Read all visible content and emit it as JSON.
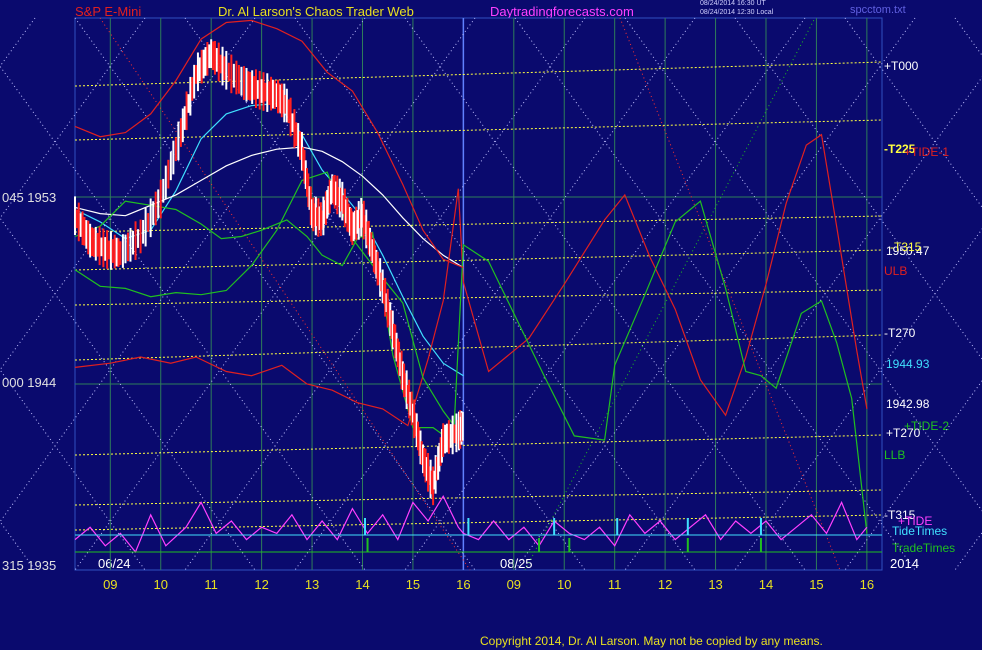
{
  "header": {
    "left_title": "S&P E-Mini",
    "center_title": "Dr. Al Larson's Chaos Trader Web",
    "site": "Daytradingforecasts.com",
    "stamp_line1": "08/24/2014 16:30 UT",
    "stamp_line2": "08/24/2014 12:30 Local",
    "file": "spcctom.txt"
  },
  "footer": {
    "copyright": "Copyright 2014, Dr. Al Larson. May not be copied by any means."
  },
  "colors": {
    "background": "#0a0a6e",
    "price_up": "#ffffff",
    "price_down": "#ff2020",
    "ma_fast": "#40e0ff",
    "ma_slow": "#ffffff",
    "red_band": "#e02020",
    "green_band": "#20c020",
    "tide": "#ff40ff",
    "gann_yellow": "#ffff40",
    "grid": "#2e7d5a",
    "tide_times": "#40e0ff",
    "trade_times": "#20c020"
  },
  "left_axis_labels": [
    {
      "text": "045  1953",
      "value": 1953
    },
    {
      "text": "000  1944",
      "value": 1944
    },
    {
      "text": "315  1935",
      "value": 1935
    }
  ],
  "right_labels": [
    {
      "text": "+T000",
      "color": "#ffffff"
    },
    {
      "text": "-T225",
      "color": "#ffff40"
    },
    {
      "text": "+TIDE-1",
      "color": "#e02020"
    },
    {
      "text": "1950.47",
      "color": "#ffffff"
    },
    {
      "text": "-T315",
      "color": "#ffff40"
    },
    {
      "text": "ULB",
      "color": "#e02020"
    },
    {
      "text": "-T270",
      "color": "#ffffff"
    },
    {
      "text": "1944.93",
      "color": "#40e0ff"
    },
    {
      "text": "1942.98",
      "color": "#ffffff"
    },
    {
      "text": "+T270",
      "color": "#ffffff"
    },
    {
      "text": "+TIDE-2",
      "color": "#20c020"
    },
    {
      "text": "LLB",
      "color": "#20c020"
    },
    {
      "text": "-T315",
      "color": "#ffffff"
    },
    {
      "text": "+TIDE",
      "color": "#ff40ff"
    },
    {
      "text": "TideTimes",
      "color": "#40e0ff"
    },
    {
      "text": "TradeTimes",
      "color": "#20c020"
    },
    {
      "text": "2014",
      "color": "#ffffff"
    }
  ],
  "date_labels": [
    "06/24",
    "08/25"
  ],
  "chart_data": {
    "type": "line",
    "title": "S&P E-Mini",
    "ylim": [
      1935,
      1956
    ],
    "xlim": [
      8.3,
      24.3
    ],
    "x_ticks": [
      {
        "x": 9,
        "label": "09"
      },
      {
        "x": 10,
        "label": "10"
      },
      {
        "x": 11,
        "label": "11"
      },
      {
        "x": 12,
        "label": "12"
      },
      {
        "x": 13,
        "label": "13"
      },
      {
        "x": 14,
        "label": "14"
      },
      {
        "x": 15,
        "label": "15"
      },
      {
        "x": 16,
        "label": "16"
      },
      {
        "x": 17,
        "label": "09"
      },
      {
        "x": 18,
        "label": "10"
      },
      {
        "x": 19,
        "label": "11"
      },
      {
        "x": 20,
        "label": "12"
      },
      {
        "x": 21,
        "label": "13"
      },
      {
        "x": 22,
        "label": "14"
      },
      {
        "x": 23,
        "label": "15"
      },
      {
        "x": 24,
        "label": "16"
      }
    ],
    "price": {
      "x": [
        8.3,
        8.6,
        8.9,
        9.2,
        9.6,
        10.0,
        10.4,
        10.7,
        11.0,
        11.3,
        11.7,
        12.0,
        12.3,
        12.5,
        12.8,
        13.0,
        13.2,
        13.4,
        13.6,
        13.8,
        14.0,
        14.2,
        14.4,
        14.6,
        14.8,
        15.0,
        15.2,
        15.4,
        15.6,
        15.9,
        16.0
      ],
      "values": [
        1952.1,
        1950.9,
        1950.5,
        1950.3,
        1951.1,
        1952.9,
        1956.1,
        1958.9,
        1959.9,
        1959.1,
        1958.4,
        1958.1,
        1957.9,
        1957.4,
        1955.2,
        1952.2,
        1951.9,
        1953.4,
        1952.8,
        1951.5,
        1952.1,
        1950.4,
        1948.7,
        1946.6,
        1944.4,
        1942.6,
        1940.4,
        1939.1,
        1941.3,
        1941.7,
        1942.0
      ]
    },
    "series": [
      {
        "name": "1944.93",
        "color": "#40e0ff",
        "x": [
          8.3,
          8.8,
          9.3,
          9.8,
          10.3,
          10.8,
          11.3,
          11.8,
          12.3,
          12.8,
          13.2,
          13.6,
          14.0,
          14.4,
          14.8,
          15.2,
          15.6,
          16.0
        ],
        "values": [
          1952.4,
          1951.8,
          1951.0,
          1951.4,
          1953.3,
          1955.8,
          1957.0,
          1957.4,
          1957.5,
          1956.0,
          1954.3,
          1953.2,
          1952.0,
          1950.2,
          1948.2,
          1946.3,
          1945.0,
          1944.4
        ]
      },
      {
        "name": "1942.98",
        "color": "#ffffff",
        "x": [
          8.3,
          8.8,
          9.3,
          9.8,
          10.3,
          10.8,
          11.3,
          11.8,
          12.3,
          12.8,
          13.2,
          13.6,
          14.0,
          14.4,
          14.8,
          15.2,
          15.6,
          16.0
        ],
        "values": [
          1952.5,
          1952.2,
          1952.1,
          1952.6,
          1953.1,
          1953.8,
          1954.5,
          1955.0,
          1955.3,
          1955.4,
          1955.2,
          1954.7,
          1954.0,
          1953.1,
          1952.0,
          1951.0,
          1950.2,
          1949.6
        ]
      },
      {
        "name": "ULB",
        "color": "#e02020",
        "x": [
          8.3,
          9.0,
          9.6,
          10.2,
          10.7,
          11.3,
          11.8,
          12.4,
          12.9,
          13.4,
          13.9,
          14.4,
          14.9,
          15.3,
          15.6,
          15.9,
          16.0,
          16.5,
          17.3,
          18.0,
          18.8,
          19.2,
          19.7,
          20.2,
          20.7,
          21.2,
          21.6,
          22.0,
          22.4,
          22.8,
          23.1,
          23.4,
          23.8,
          24.0
        ],
        "values": [
          1944.8,
          1945.0,
          1945.3,
          1945.0,
          1945.3,
          1944.6,
          1944.4,
          1944.9,
          1944.0,
          1943.7,
          1943.1,
          1942.8,
          1942.0,
          1945.2,
          1948.0,
          1953.4,
          1948.9,
          1944.6,
          1946.2,
          1948.8,
          1951.9,
          1953.1,
          1950.1,
          1947.6,
          1944.2,
          1942.5,
          1945.3,
          1948.8,
          1952.7,
          1955.5,
          1956.0,
          1951.6,
          1945.6,
          1942.8
        ]
      },
      {
        "name": "LLB",
        "color": "#20c020",
        "x": [
          8.3,
          8.8,
          9.3,
          9.8,
          10.3,
          10.8,
          11.2,
          11.6,
          12.0,
          12.5,
          12.9,
          13.2,
          13.6,
          13.9,
          14.2,
          14.6,
          15.0,
          15.4,
          15.8,
          16.0,
          16.5,
          17.0,
          17.6,
          18.2,
          18.8,
          19.0,
          19.6,
          20.2,
          20.7,
          21.2,
          21.6,
          21.9,
          22.2,
          22.7,
          23.1,
          23.4,
          23.7,
          24.0
        ],
        "values": [
          1951.1,
          1951.6,
          1952.8,
          1952.6,
          1952.4,
          1951.7,
          1951.0,
          1951.1,
          1951.4,
          1951.9,
          1951.1,
          1950.2,
          1949.7,
          1951.0,
          1951.3,
          1945.4,
          1941.9,
          1941.9,
          1941.2,
          1950.7,
          1949.9,
          1947.4,
          1944.4,
          1941.5,
          1941.3,
          1944.9,
          1948.3,
          1951.8,
          1952.8,
          1948.6,
          1944.6,
          1944.4,
          1943.8,
          1947.4,
          1948.0,
          1946.0,
          1943.3,
          1936.8
        ]
      },
      {
        "name": "Red envelope upper",
        "color": "#e02020",
        "x": [
          8.3,
          8.8,
          9.3,
          9.8,
          10.3,
          10.8,
          11.3,
          11.8,
          12.3,
          12.8,
          13.3,
          13.8,
          14.3,
          14.8,
          15.2,
          15.6,
          16.0
        ],
        "values": [
          1956.4,
          1955.9,
          1956.1,
          1957.0,
          1958.6,
          1960.6,
          1961.4,
          1961.5,
          1961.1,
          1960.5,
          1959.0,
          1958.1,
          1956.1,
          1953.6,
          1951.4,
          1950.0,
          1949.6
        ]
      },
      {
        "name": "Green envelope lower",
        "color": "#20c020",
        "x": [
          8.3,
          8.8,
          9.3,
          9.8,
          10.3,
          10.8,
          11.3,
          11.8,
          12.3,
          12.8,
          13.3,
          13.8,
          14.3,
          14.8,
          15.2,
          15.6,
          16.0
        ],
        "values": [
          1949.5,
          1948.7,
          1948.6,
          1948.2,
          1948.4,
          1948.3,
          1948.5,
          1949.7,
          1951.4,
          1953.8,
          1954.2,
          1951.0,
          1949.4,
          1947.9,
          1944.3,
          1942.7,
          1941.4
        ]
      }
    ],
    "tide_indicator": {
      "name": "+TIDE",
      "color": "#ff40ff",
      "x": [
        8.3,
        8.6,
        8.9,
        9.2,
        9.5,
        9.8,
        10.1,
        10.5,
        10.8,
        11.1,
        11.4,
        11.7,
        12.0,
        12.3,
        12.6,
        12.9,
        13.2,
        13.5,
        13.8,
        14.1,
        14.4,
        14.7,
        15.0,
        15.3,
        15.6,
        15.9,
        16.0,
        16.3,
        16.6,
        16.9,
        17.2,
        17.5,
        17.8,
        18.1,
        18.4,
        18.7,
        19.0,
        19.3,
        19.6,
        19.9,
        20.2,
        20.5,
        20.8,
        21.1,
        21.4,
        21.7,
        22.0,
        22.3,
        22.6,
        22.9,
        23.2,
        23.5,
        23.8,
        24.0
      ],
      "values": [
        0.2,
        0.4,
        0.1,
        0.3,
        0.0,
        0.6,
        0.1,
        0.4,
        0.8,
        0.3,
        0.5,
        0.2,
        0.4,
        0.3,
        0.6,
        0.2,
        0.5,
        0.2,
        0.7,
        0.3,
        0.6,
        0.2,
        0.8,
        0.5,
        0.9,
        0.4,
        0.3,
        0.2,
        0.5,
        0.2,
        0.4,
        0.1,
        0.5,
        0.3,
        0.2,
        0.4,
        0.1,
        0.6,
        0.3,
        0.5,
        0.2,
        0.4,
        0.6,
        0.2,
        0.5,
        0.3,
        0.5,
        0.2,
        0.4,
        0.6,
        0.3,
        0.8,
        0.2,
        0.4
      ]
    },
    "tide_times": [
      14.05,
      16.1,
      17.8,
      19.05,
      20.45,
      21.9
    ],
    "trade_times": [
      14.1,
      17.5,
      18.1,
      20.45,
      21.9
    ]
  }
}
